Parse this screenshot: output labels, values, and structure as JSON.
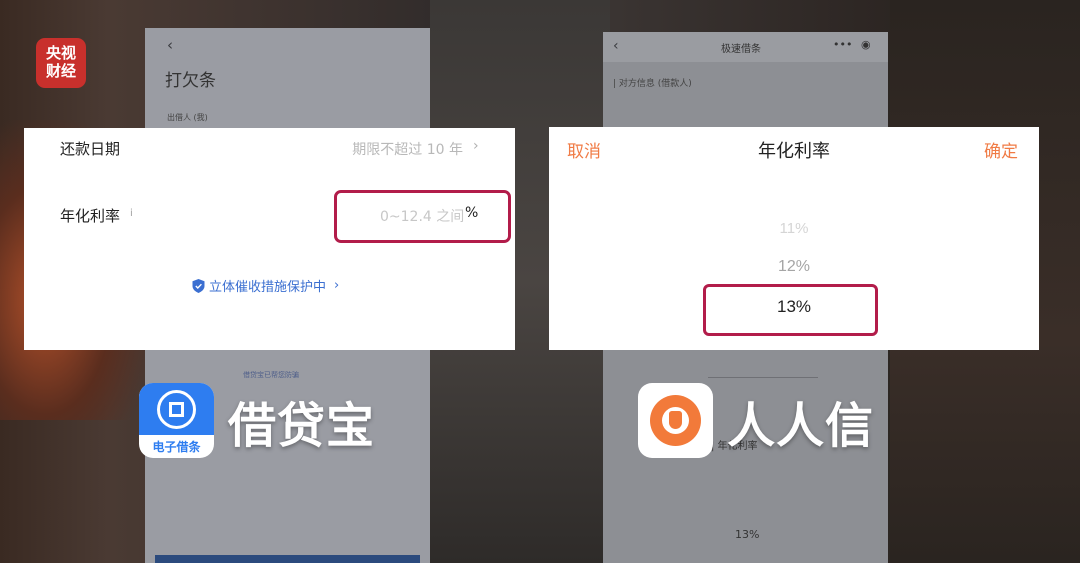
{
  "watermark": {
    "line1": "央视",
    "line2": "财经"
  },
  "left_phone": {
    "back_glyph": "‹",
    "title": "打欠条",
    "lender_label": "出借人 (我)",
    "tip_text": "借贷宝已帮您防骗"
  },
  "left_card": {
    "repay_date_label": "还款日期",
    "repay_date_value": "期限不超过 10 年",
    "annual_rate_label": "年化利率",
    "annual_rate_info_glyph": "i",
    "annual_rate_hint": "0~12.4 之间",
    "annual_rate_unit": "%",
    "protection_text": "立体催收措施保护中",
    "chevron_glyph": "›",
    "highlight_color": "#b21c4a",
    "link_color": "#3b6fd1"
  },
  "left_app": {
    "icon_caption": "电子借条",
    "name": "借贷宝",
    "icon_color": "#2e7df0"
  },
  "right_phone": {
    "back_glyph": "‹",
    "title": "极速借条",
    "more_glyph": "•••",
    "close_glyph": "◉",
    "section_label": "| 对方信息 (借款人)",
    "lower_label": "| 年化利率",
    "lower_value": "13%"
  },
  "right_card": {
    "cancel_label": "取消",
    "title": "年化利率",
    "confirm_label": "确定",
    "options": [
      "11%",
      "12%",
      "13%"
    ],
    "selected": "13%",
    "action_color": "#f07b45",
    "highlight_color": "#b21c4a"
  },
  "right_app": {
    "name": "人人信",
    "icon_color": "#f27a3a"
  }
}
